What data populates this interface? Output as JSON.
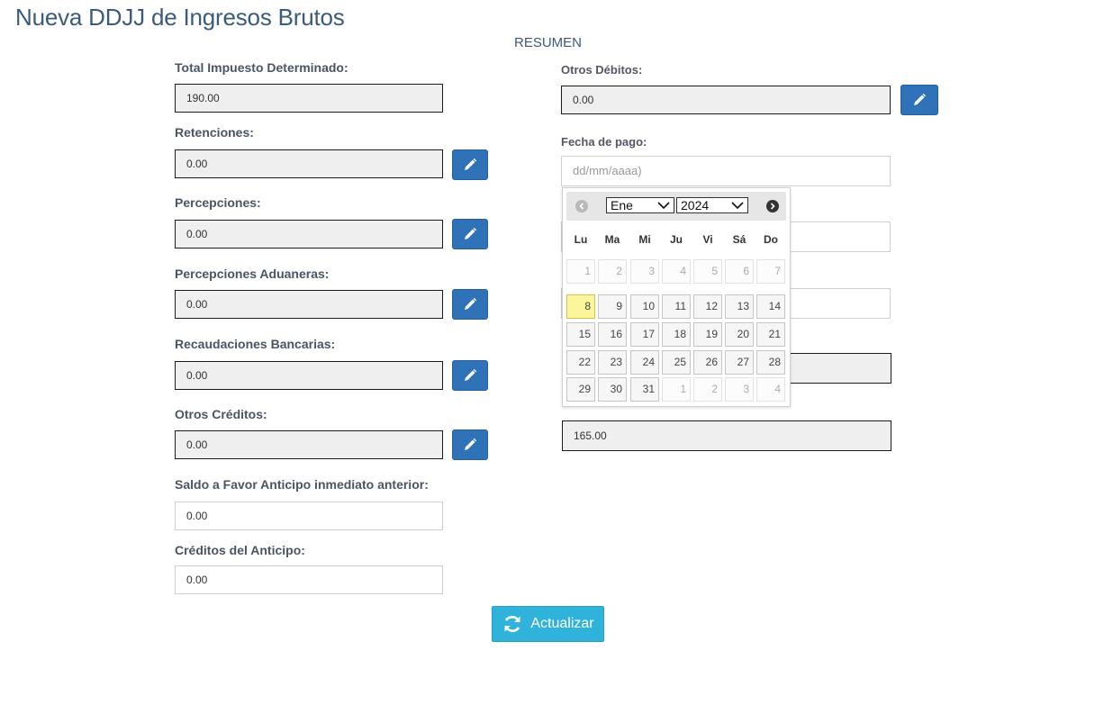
{
  "page": {
    "title": "Nueva DDJJ de Ingresos Brutos",
    "section_title": "RESUMEN"
  },
  "left_fields": [
    {
      "label": "Total Impuesto Determinado:",
      "value": "190.00",
      "editable": false
    },
    {
      "label": "Retenciones:",
      "value": "0.00",
      "editable": true
    },
    {
      "label": "Percepciones:",
      "value": "0.00",
      "editable": true
    },
    {
      "label": "Percepciones Aduaneras:",
      "value": "0.00",
      "editable": true
    },
    {
      "label": "Recaudaciones Bancarias:",
      "value": "0.00",
      "editable": true
    },
    {
      "label": "Otros Créditos:",
      "value": "0.00",
      "editable": true
    },
    {
      "label": "Saldo a Favor Anticipo inmediato anterior:",
      "value": "0.00",
      "editable": false
    },
    {
      "label": "Créditos del Anticipo:",
      "value": "0.00",
      "editable": false
    }
  ],
  "right_fields": {
    "otros_debitos": {
      "label": "Otros Débitos:",
      "value": "0.00"
    },
    "fecha_pago": {
      "label": "Fecha de pago:",
      "placeholder": "dd/mm/aaaa)"
    },
    "bottom_value": "165.00"
  },
  "datepicker": {
    "month": "Ene",
    "year": "2024",
    "weekdays": [
      "Lu",
      "Ma",
      "Mi",
      "Ju",
      "Vi",
      "Sá",
      "Do"
    ],
    "weeks": [
      [
        "1",
        "2",
        "3",
        "4",
        "5",
        "6",
        "7"
      ],
      [
        "8",
        "9",
        "10",
        "11",
        "12",
        "13",
        "14"
      ],
      [
        "15",
        "16",
        "17",
        "18",
        "19",
        "20",
        "21"
      ],
      [
        "22",
        "23",
        "24",
        "25",
        "26",
        "27",
        "28"
      ],
      [
        "29",
        "30",
        "31",
        "1",
        "2",
        "3",
        "4"
      ]
    ],
    "today": "8"
  },
  "actions": {
    "update_label": "Actualizar"
  },
  "colors": {
    "title": "#3c5a7a",
    "edit_button": "#2f72b8",
    "update_button": "#2fb3db",
    "today_highlight": "#fbf59c"
  }
}
